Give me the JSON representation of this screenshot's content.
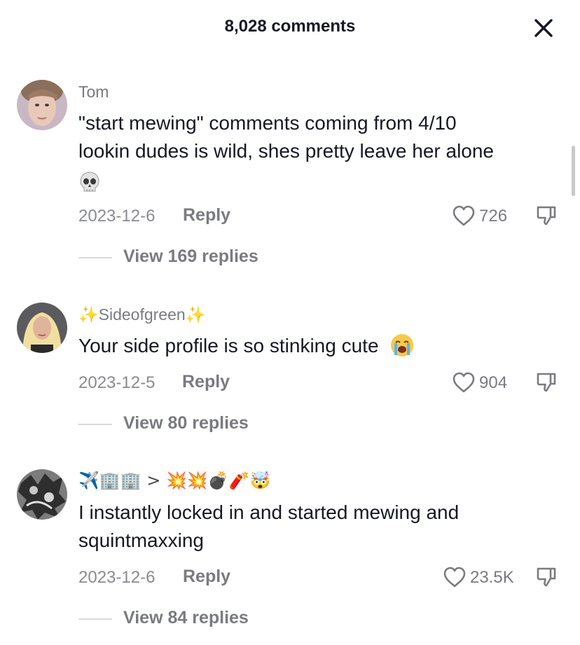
{
  "header": {
    "title": "8,028 comments"
  },
  "comments": [
    {
      "username": "Tom",
      "text_line1": "\"start mewing\" comments coming from 4/10",
      "text_line2": "lookin dudes is wild, shes pretty leave her alone",
      "emoji": "skull",
      "date": "2023-12-6",
      "reply_label": "Reply",
      "likes": "726",
      "view_replies": "View 169 replies"
    },
    {
      "username_prefix": "✨",
      "username": "Sideofgreen",
      "username_suffix": "✨",
      "text": "Your side profile is so stinking cute",
      "emoji": "loudly-crying-face",
      "date": "2023-12-5",
      "reply_label": "Reply",
      "likes": "904",
      "view_replies": "View 80 replies"
    },
    {
      "username": "✈️🏢🏢 > 💥💥💣🧨🤯",
      "text_line1": "I instantly locked in and started mewing and",
      "text_line2": "squintmaxxing",
      "date": "2023-12-6",
      "reply_label": "Reply",
      "likes": "23.5K",
      "view_replies": "View 84 replies"
    }
  ],
  "icons": {
    "close": "close-icon",
    "like": "heart-outline-icon",
    "dislike": "thumbs-down-icon"
  },
  "colors": {
    "text_primary": "#161823",
    "text_secondary": "#7a7b80",
    "background": "#ffffff"
  }
}
